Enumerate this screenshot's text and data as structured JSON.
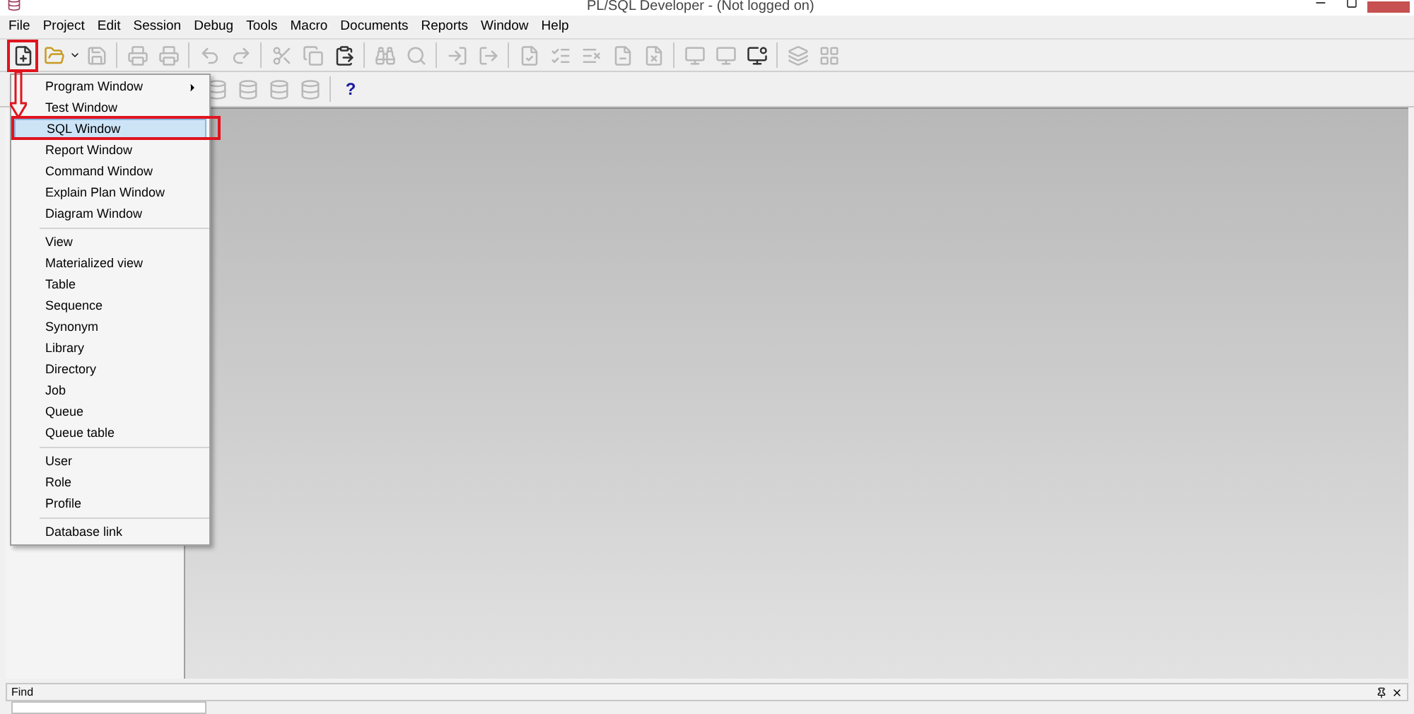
{
  "window": {
    "title": "PL/SQL Developer - (Not logged on)"
  },
  "menu_bar": [
    "File",
    "Project",
    "Edit",
    "Session",
    "Debug",
    "Tools",
    "Macro",
    "Documents",
    "Reports",
    "Window",
    "Help"
  ],
  "new_menu": {
    "groups": [
      [
        {
          "label": "Program Window",
          "selected": false,
          "submenu": true
        },
        {
          "label": "Test Window",
          "selected": false,
          "submenu": false
        },
        {
          "label": "SQL Window",
          "selected": true,
          "submenu": false
        },
        {
          "label": "Report Window",
          "selected": false,
          "submenu": false
        },
        {
          "label": "Command Window",
          "selected": false,
          "submenu": false
        },
        {
          "label": "Explain Plan Window",
          "selected": false,
          "submenu": false
        },
        {
          "label": "Diagram Window",
          "selected": false,
          "submenu": false
        }
      ],
      [
        {
          "label": "View",
          "selected": false,
          "submenu": false
        },
        {
          "label": "Materialized view",
          "selected": false,
          "submenu": false
        },
        {
          "label": "Table",
          "selected": false,
          "submenu": false
        },
        {
          "label": "Sequence",
          "selected": false,
          "submenu": false
        },
        {
          "label": "Synonym",
          "selected": false,
          "submenu": false
        },
        {
          "label": "Library",
          "selected": false,
          "submenu": false
        },
        {
          "label": "Directory",
          "selected": false,
          "submenu": false
        },
        {
          "label": "Job",
          "selected": false,
          "submenu": false
        },
        {
          "label": "Queue",
          "selected": false,
          "submenu": false
        },
        {
          "label": "Queue table",
          "selected": false,
          "submenu": false
        }
      ],
      [
        {
          "label": "User",
          "selected": false,
          "submenu": false
        },
        {
          "label": "Role",
          "selected": false,
          "submenu": false
        },
        {
          "label": "Profile",
          "selected": false,
          "submenu": false
        }
      ],
      [
        {
          "label": "Database link",
          "selected": false,
          "submenu": false
        }
      ]
    ]
  },
  "help_button": {
    "label": "?"
  },
  "find_bar": {
    "title": "Find"
  }
}
